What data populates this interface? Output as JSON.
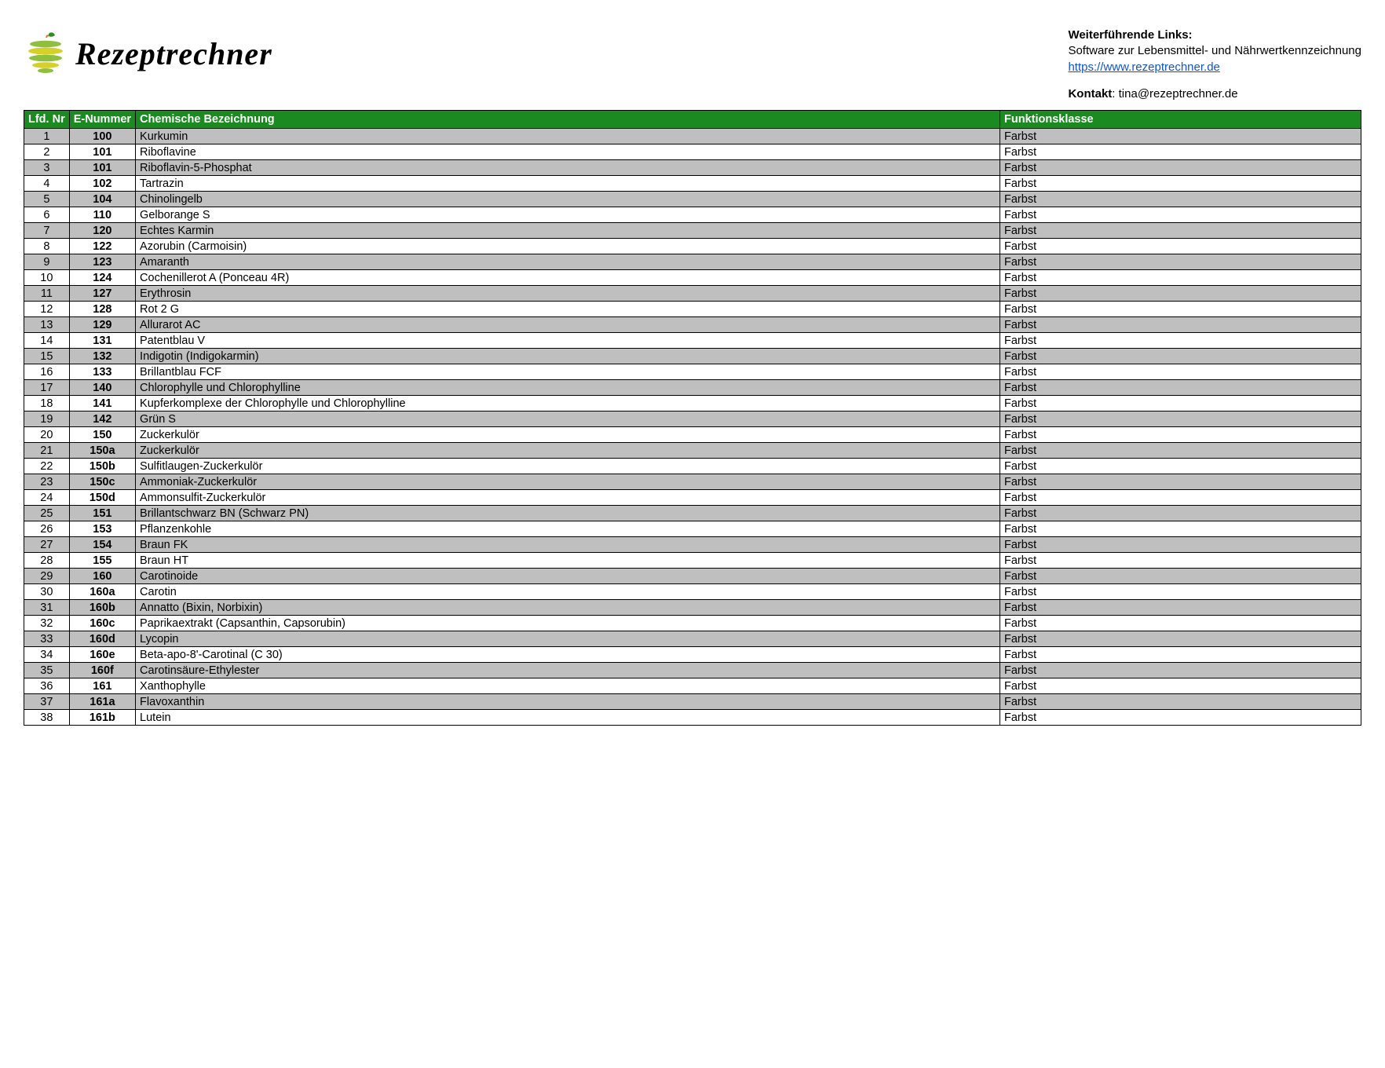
{
  "brand": {
    "name": "Rezeptrechner"
  },
  "links": {
    "heading": "Weiterführende Links:",
    "software_line": "Software zur Lebensmittel- und Nährwertkennzeichnung",
    "url_text": "https://www.rezeptrechner.de",
    "contact_label": "Kontakt",
    "contact_value": ": tina@rezeptrechner.de"
  },
  "table": {
    "headers": {
      "lfd": "Lfd. Nr",
      "enummer": "E-Nummer",
      "chem": "Chemische Bezeichnung",
      "funk": "Funktionsklasse"
    },
    "rows": [
      {
        "lfd": "1",
        "e": "100",
        "chem": "Kurkumin",
        "funk": "Farbst"
      },
      {
        "lfd": "2",
        "e": "101",
        "chem": "Riboflavine",
        "funk": "Farbst"
      },
      {
        "lfd": "3",
        "e": "101",
        "chem": "Riboflavin-5-Phosphat",
        "funk": "Farbst"
      },
      {
        "lfd": "4",
        "e": "102",
        "chem": "Tartrazin",
        "funk": "Farbst"
      },
      {
        "lfd": "5",
        "e": "104",
        "chem": "Chinolingelb",
        "funk": "Farbst"
      },
      {
        "lfd": "6",
        "e": "110",
        "chem": "Gelborange S",
        "funk": "Farbst"
      },
      {
        "lfd": "7",
        "e": "120",
        "chem": "Echtes Karmin",
        "funk": "Farbst"
      },
      {
        "lfd": "8",
        "e": "122",
        "chem": "Azorubin (Carmoisin)",
        "funk": "Farbst"
      },
      {
        "lfd": "9",
        "e": "123",
        "chem": "Amaranth",
        "funk": "Farbst"
      },
      {
        "lfd": "10",
        "e": "124",
        "chem": "Cochenillerot A (Ponceau 4R)",
        "funk": "Farbst"
      },
      {
        "lfd": "11",
        "e": "127",
        "chem": "Erythrosin",
        "funk": "Farbst"
      },
      {
        "lfd": "12",
        "e": "128",
        "chem": "Rot 2 G",
        "funk": "Farbst"
      },
      {
        "lfd": "13",
        "e": "129",
        "chem": "Allurarot AC",
        "funk": "Farbst"
      },
      {
        "lfd": "14",
        "e": "131",
        "chem": "Patentblau V",
        "funk": "Farbst"
      },
      {
        "lfd": "15",
        "e": "132",
        "chem": "Indigotin (Indigokarmin)",
        "funk": "Farbst"
      },
      {
        "lfd": "16",
        "e": "133",
        "chem": "Brillantblau FCF",
        "funk": "Farbst"
      },
      {
        "lfd": "17",
        "e": "140",
        "chem": "Chlorophylle und Chlorophylline",
        "funk": "Farbst"
      },
      {
        "lfd": "18",
        "e": "141",
        "chem": "Kupferkomplexe der Chlorophylle und Chlorophylline",
        "funk": "Farbst"
      },
      {
        "lfd": "19",
        "e": "142",
        "chem": "Grün S",
        "funk": "Farbst"
      },
      {
        "lfd": "20",
        "e": "150",
        "chem": "Zuckerkulör",
        "funk": "Farbst"
      },
      {
        "lfd": "21",
        "e": "150a",
        "chem": "Zuckerkulör",
        "funk": "Farbst"
      },
      {
        "lfd": "22",
        "e": "150b",
        "chem": "Sulfitlaugen-Zuckerkulör",
        "funk": "Farbst"
      },
      {
        "lfd": "23",
        "e": "150c",
        "chem": "Ammoniak-Zuckerkulör",
        "funk": "Farbst"
      },
      {
        "lfd": "24",
        "e": "150d",
        "chem": "Ammonsulfit-Zuckerkulör",
        "funk": "Farbst"
      },
      {
        "lfd": "25",
        "e": "151",
        "chem": "Brillantschwarz BN (Schwarz PN)",
        "funk": "Farbst"
      },
      {
        "lfd": "26",
        "e": "153",
        "chem": "Pflanzenkohle",
        "funk": "Farbst"
      },
      {
        "lfd": "27",
        "e": "154",
        "chem": "Braun FK",
        "funk": "Farbst"
      },
      {
        "lfd": "28",
        "e": "155",
        "chem": "Braun HT",
        "funk": "Farbst"
      },
      {
        "lfd": "29",
        "e": "160",
        "chem": "Carotinoide",
        "funk": "Farbst"
      },
      {
        "lfd": "30",
        "e": "160a",
        "chem": "Carotin",
        "funk": "Farbst"
      },
      {
        "lfd": "31",
        "e": "160b",
        "chem": "Annatto (Bixin, Norbixin)",
        "funk": "Farbst"
      },
      {
        "lfd": "32",
        "e": "160c",
        "chem": "Paprikaextrakt (Capsanthin, Capsorubin)",
        "funk": "Farbst"
      },
      {
        "lfd": "33",
        "e": "160d",
        "chem": "Lycopin",
        "funk": "Farbst"
      },
      {
        "lfd": "34",
        "e": "160e",
        "chem": "Beta-apo-8'-Carotinal (C 30)",
        "funk": "Farbst"
      },
      {
        "lfd": "35",
        "e": "160f",
        "chem": "Carotinsäure-Ethylester",
        "funk": "Farbst"
      },
      {
        "lfd": "36",
        "e": "161",
        "chem": "Xanthophylle",
        "funk": "Farbst"
      },
      {
        "lfd": "37",
        "e": "161a",
        "chem": "Flavoxanthin",
        "funk": "Farbst"
      },
      {
        "lfd": "38",
        "e": "161b",
        "chem": "Lutein",
        "funk": "Farbst"
      }
    ]
  }
}
